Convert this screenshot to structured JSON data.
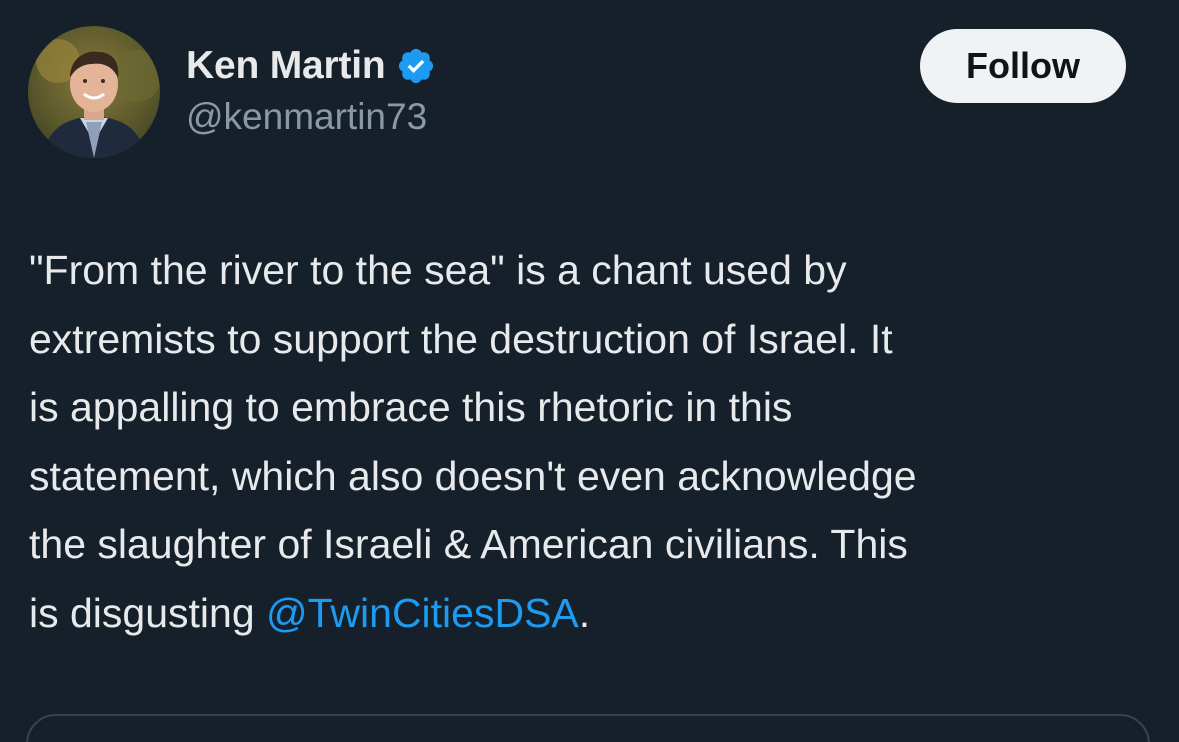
{
  "author": {
    "name": "Ken Martin",
    "handle": "@kenmartin73",
    "verified_icon": "verified-badge-icon",
    "verified_color": "#1d9bf0"
  },
  "follow_button": {
    "label": "Follow"
  },
  "tweet": {
    "lines": [
      "\"From the river to the sea\" is a chant used by",
      "extremists to support the destruction of Israel. It",
      "is appalling to embrace this rhetoric in this",
      "statement, which also doesn't even acknowledge",
      "the slaughter of Israeli & American civilians. This"
    ],
    "last_line_prefix": "is disgusting ",
    "mention": "@TwinCitiesDSA",
    "last_line_suffix": ".",
    "mention_color": "#1d9bf0"
  },
  "theme": {
    "background": "#15202b",
    "text": "#e7e9ea",
    "secondary_text": "#8b98a5",
    "border": "#38444d"
  }
}
